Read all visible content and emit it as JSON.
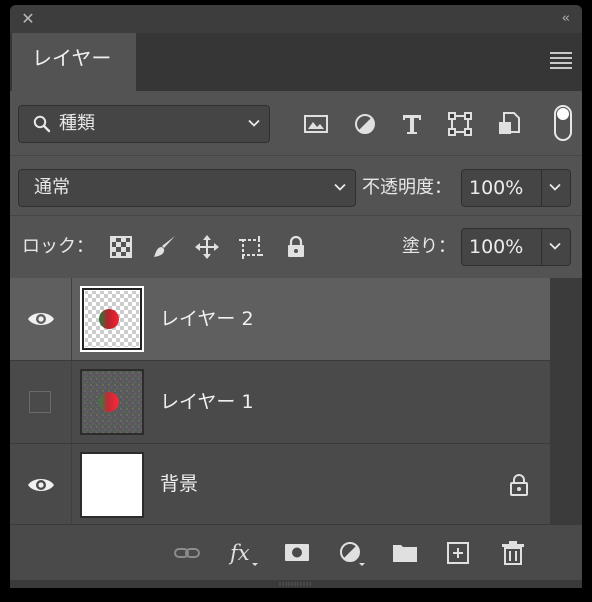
{
  "titlebar": {
    "close_glyph": "✕",
    "collapse_glyph": "‹‹"
  },
  "tab": {
    "label": "レイヤー"
  },
  "filter": {
    "dropdown_label": "種類",
    "icons": [
      "image-filter-icon",
      "adjustment-filter-icon",
      "type-filter-icon",
      "shape-filter-icon",
      "smart-object-filter-icon"
    ]
  },
  "blend": {
    "mode": "通常",
    "opacity_label": "不透明度：",
    "opacity_value": "100%"
  },
  "lock": {
    "label": "ロック：",
    "icons": [
      "lock-transparent-pixels-icon",
      "lock-image-pixels-icon",
      "lock-position-icon",
      "lock-artboard-icon",
      "lock-all-icon"
    ],
    "fill_label": "塗り：",
    "fill_value": "100%"
  },
  "layers": [
    {
      "name": "レイヤー 2",
      "visible": true,
      "selected": true,
      "locked": false
    },
    {
      "name": "レイヤー 1",
      "visible": false,
      "selected": false,
      "locked": false
    },
    {
      "name": "背景",
      "visible": true,
      "selected": false,
      "locked": true
    }
  ],
  "bottom_icons": [
    "link-layers-icon",
    "fx-icon",
    "add-mask-icon",
    "adjustment-layer-icon",
    "new-group-icon",
    "new-layer-icon",
    "delete-icon"
  ],
  "colors": {
    "panel": "#535353",
    "selected_layer": "#5f5f5f",
    "background": "#000000"
  }
}
